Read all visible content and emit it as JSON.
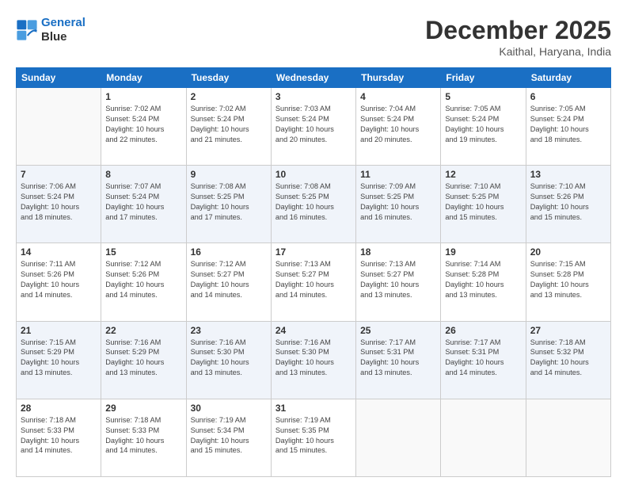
{
  "logo": {
    "line1": "General",
    "line2": "Blue"
  },
  "title": "December 2025",
  "subtitle": "Kaithal, Haryana, India",
  "weekdays": [
    "Sunday",
    "Monday",
    "Tuesday",
    "Wednesday",
    "Thursday",
    "Friday",
    "Saturday"
  ],
  "weeks": [
    [
      {
        "day": "",
        "empty": true
      },
      {
        "day": "1",
        "sunrise": "7:02 AM",
        "sunset": "5:24 PM",
        "daylight": "10 hours and 22 minutes."
      },
      {
        "day": "2",
        "sunrise": "7:02 AM",
        "sunset": "5:24 PM",
        "daylight": "10 hours and 21 minutes."
      },
      {
        "day": "3",
        "sunrise": "7:03 AM",
        "sunset": "5:24 PM",
        "daylight": "10 hours and 20 minutes."
      },
      {
        "day": "4",
        "sunrise": "7:04 AM",
        "sunset": "5:24 PM",
        "daylight": "10 hours and 20 minutes."
      },
      {
        "day": "5",
        "sunrise": "7:05 AM",
        "sunset": "5:24 PM",
        "daylight": "10 hours and 19 minutes."
      },
      {
        "day": "6",
        "sunrise": "7:05 AM",
        "sunset": "5:24 PM",
        "daylight": "10 hours and 18 minutes."
      }
    ],
    [
      {
        "day": "7",
        "sunrise": "7:06 AM",
        "sunset": "5:24 PM",
        "daylight": "10 hours and 18 minutes."
      },
      {
        "day": "8",
        "sunrise": "7:07 AM",
        "sunset": "5:24 PM",
        "daylight": "10 hours and 17 minutes."
      },
      {
        "day": "9",
        "sunrise": "7:08 AM",
        "sunset": "5:25 PM",
        "daylight": "10 hours and 17 minutes."
      },
      {
        "day": "10",
        "sunrise": "7:08 AM",
        "sunset": "5:25 PM",
        "daylight": "10 hours and 16 minutes."
      },
      {
        "day": "11",
        "sunrise": "7:09 AM",
        "sunset": "5:25 PM",
        "daylight": "10 hours and 16 minutes."
      },
      {
        "day": "12",
        "sunrise": "7:10 AM",
        "sunset": "5:25 PM",
        "daylight": "10 hours and 15 minutes."
      },
      {
        "day": "13",
        "sunrise": "7:10 AM",
        "sunset": "5:26 PM",
        "daylight": "10 hours and 15 minutes."
      }
    ],
    [
      {
        "day": "14",
        "sunrise": "7:11 AM",
        "sunset": "5:26 PM",
        "daylight": "10 hours and 14 minutes."
      },
      {
        "day": "15",
        "sunrise": "7:12 AM",
        "sunset": "5:26 PM",
        "daylight": "10 hours and 14 minutes."
      },
      {
        "day": "16",
        "sunrise": "7:12 AM",
        "sunset": "5:27 PM",
        "daylight": "10 hours and 14 minutes."
      },
      {
        "day": "17",
        "sunrise": "7:13 AM",
        "sunset": "5:27 PM",
        "daylight": "10 hours and 14 minutes."
      },
      {
        "day": "18",
        "sunrise": "7:13 AM",
        "sunset": "5:27 PM",
        "daylight": "10 hours and 13 minutes."
      },
      {
        "day": "19",
        "sunrise": "7:14 AM",
        "sunset": "5:28 PM",
        "daylight": "10 hours and 13 minutes."
      },
      {
        "day": "20",
        "sunrise": "7:15 AM",
        "sunset": "5:28 PM",
        "daylight": "10 hours and 13 minutes."
      }
    ],
    [
      {
        "day": "21",
        "sunrise": "7:15 AM",
        "sunset": "5:29 PM",
        "daylight": "10 hours and 13 minutes."
      },
      {
        "day": "22",
        "sunrise": "7:16 AM",
        "sunset": "5:29 PM",
        "daylight": "10 hours and 13 minutes."
      },
      {
        "day": "23",
        "sunrise": "7:16 AM",
        "sunset": "5:30 PM",
        "daylight": "10 hours and 13 minutes."
      },
      {
        "day": "24",
        "sunrise": "7:16 AM",
        "sunset": "5:30 PM",
        "daylight": "10 hours and 13 minutes."
      },
      {
        "day": "25",
        "sunrise": "7:17 AM",
        "sunset": "5:31 PM",
        "daylight": "10 hours and 13 minutes."
      },
      {
        "day": "26",
        "sunrise": "7:17 AM",
        "sunset": "5:31 PM",
        "daylight": "10 hours and 14 minutes."
      },
      {
        "day": "27",
        "sunrise": "7:18 AM",
        "sunset": "5:32 PM",
        "daylight": "10 hours and 14 minutes."
      }
    ],
    [
      {
        "day": "28",
        "sunrise": "7:18 AM",
        "sunset": "5:33 PM",
        "daylight": "10 hours and 14 minutes."
      },
      {
        "day": "29",
        "sunrise": "7:18 AM",
        "sunset": "5:33 PM",
        "daylight": "10 hours and 14 minutes."
      },
      {
        "day": "30",
        "sunrise": "7:19 AM",
        "sunset": "5:34 PM",
        "daylight": "10 hours and 15 minutes."
      },
      {
        "day": "31",
        "sunrise": "7:19 AM",
        "sunset": "5:35 PM",
        "daylight": "10 hours and 15 minutes."
      },
      {
        "day": "",
        "empty": true
      },
      {
        "day": "",
        "empty": true
      },
      {
        "day": "",
        "empty": true
      }
    ]
  ]
}
